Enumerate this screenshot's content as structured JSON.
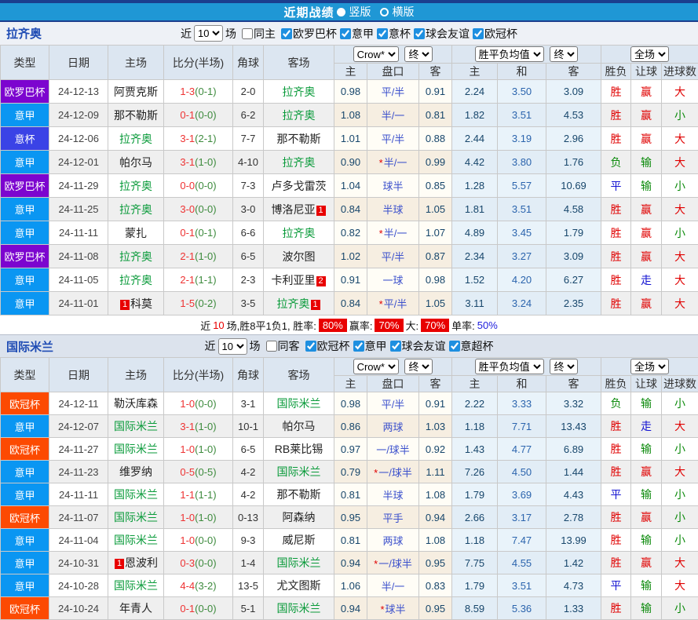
{
  "topbar": {
    "title": "近期战绩",
    "vertical_label": "竖版",
    "horizontal_label": "横版"
  },
  "colors": {
    "bar_blue": "#1f97d5",
    "bar_navy": "#1b3e8e",
    "rate_box_red": "#e80000",
    "team_green": "#089a39",
    "badges": {
      "欧罗巴杯": "#7c05cf",
      "意甲": "#0a96f2",
      "意杯": "#3a43e6",
      "欧冠杯": "#fc4a02"
    },
    "results": {
      "胜": "#e00000",
      "平": "#1414d2",
      "负": "#0b8a0b",
      "赢": "#e00000",
      "走": "#1414d2",
      "输": "#0b8a0b",
      "大": "#e00000",
      "小": "#0b8a0b"
    }
  },
  "table_header": {
    "type": "类型",
    "date": "日期",
    "home": "主场",
    "score": "比分(半场)",
    "corner": "角球",
    "away": "客场",
    "odds_company": "Crow*",
    "final_label": "终",
    "europe_label": "胜平负均值",
    "full_label": "全场",
    "sub_home": "主",
    "sub_line": "盘口",
    "sub_away": "客",
    "sub_eu_home": "主",
    "sub_eu_draw": "和",
    "sub_eu_away": "客",
    "sub_wdl": "胜负",
    "sub_handicap": "让球",
    "sub_goals": "进球数"
  },
  "sections": [
    {
      "team": "拉齐奥",
      "filters": {
        "near": "近",
        "count": "10",
        "unit": "场",
        "same_label": "同主",
        "same_checked": false,
        "competitions": [
          "欧罗巴杯",
          "意甲",
          "意杯",
          "球会友谊",
          "欧冠杯"
        ]
      },
      "rows": [
        {
          "type": "欧罗巴杯",
          "date": "24-12-13",
          "home": "阿贾克斯",
          "hG": 0,
          "hB": "",
          "score": "1-3",
          "half": "(0-1)",
          "corner": "2-0",
          "away": "拉齐奥",
          "aG": 1,
          "aB": "",
          "h": "0.98",
          "line": "平/半",
          "star": 0,
          "a": "0.91",
          "eh": "2.24",
          "ed": "3.50",
          "ea": "3.09",
          "r1": "胜",
          "r2": "赢",
          "r3": "大"
        },
        {
          "type": "意甲",
          "date": "24-12-09",
          "home": "那不勒斯",
          "hG": 0,
          "hB": "",
          "score": "0-1",
          "half": "(0-0)",
          "corner": "6-2",
          "away": "拉齐奥",
          "aG": 1,
          "aB": "",
          "h": "1.08",
          "line": "半/一",
          "star": 0,
          "a": "0.81",
          "eh": "1.82",
          "ed": "3.51",
          "ea": "4.53",
          "r1": "胜",
          "r2": "赢",
          "r3": "小"
        },
        {
          "type": "意杯",
          "date": "24-12-06",
          "home": "拉齐奥",
          "hG": 1,
          "hB": "",
          "score": "3-1",
          "half": "(2-1)",
          "corner": "7-7",
          "away": "那不勒斯",
          "aG": 0,
          "aB": "",
          "h": "1.01",
          "line": "平/半",
          "star": 0,
          "a": "0.88",
          "eh": "2.44",
          "ed": "3.19",
          "ea": "2.96",
          "r1": "胜",
          "r2": "赢",
          "r3": "大"
        },
        {
          "type": "意甲",
          "date": "24-12-01",
          "home": "帕尔马",
          "hG": 0,
          "hB": "",
          "score": "3-1",
          "half": "(1-0)",
          "corner": "4-10",
          "away": "拉齐奥",
          "aG": 1,
          "aB": "",
          "h": "0.90",
          "line": "半/一",
          "star": 1,
          "a": "0.99",
          "eh": "4.42",
          "ed": "3.80",
          "ea": "1.76",
          "r1": "负",
          "r2": "输",
          "r3": "大"
        },
        {
          "type": "欧罗巴杯",
          "date": "24-11-29",
          "home": "拉齐奥",
          "hG": 1,
          "hB": "",
          "score": "0-0",
          "half": "(0-0)",
          "corner": "7-3",
          "away": "卢多戈雷茨",
          "aG": 0,
          "aB": "",
          "h": "1.04",
          "line": "球半",
          "star": 0,
          "a": "0.85",
          "eh": "1.28",
          "ed": "5.57",
          "ea": "10.69",
          "r1": "平",
          "r2": "输",
          "r3": "小"
        },
        {
          "type": "意甲",
          "date": "24-11-25",
          "home": "拉齐奥",
          "hG": 1,
          "hB": "",
          "score": "3-0",
          "half": "(0-0)",
          "corner": "3-0",
          "away": "博洛尼亚",
          "aG": 0,
          "aB": "1",
          "h": "0.84",
          "line": "半球",
          "star": 0,
          "a": "1.05",
          "eh": "1.81",
          "ed": "3.51",
          "ea": "4.58",
          "r1": "胜",
          "r2": "赢",
          "r3": "大"
        },
        {
          "type": "意甲",
          "date": "24-11-11",
          "home": "蒙扎",
          "hG": 0,
          "hB": "",
          "score": "0-1",
          "half": "(0-1)",
          "corner": "6-6",
          "away": "拉齐奥",
          "aG": 1,
          "aB": "",
          "h": "0.82",
          "line": "半/一",
          "star": 1,
          "a": "1.07",
          "eh": "4.89",
          "ed": "3.45",
          "ea": "1.79",
          "r1": "胜",
          "r2": "赢",
          "r3": "小"
        },
        {
          "type": "欧罗巴杯",
          "date": "24-11-08",
          "home": "拉齐奥",
          "hG": 1,
          "hB": "",
          "score": "2-1",
          "half": "(1-0)",
          "corner": "6-5",
          "away": "波尔图",
          "aG": 0,
          "aB": "",
          "h": "1.02",
          "line": "平/半",
          "star": 0,
          "a": "0.87",
          "eh": "2.34",
          "ed": "3.27",
          "ea": "3.09",
          "r1": "胜",
          "r2": "赢",
          "r3": "大"
        },
        {
          "type": "意甲",
          "date": "24-11-05",
          "home": "拉齐奥",
          "hG": 1,
          "hB": "",
          "score": "2-1",
          "half": "(1-1)",
          "corner": "2-3",
          "away": "卡利亚里",
          "aG": 0,
          "aB": "2",
          "h": "0.91",
          "line": "一球",
          "star": 0,
          "a": "0.98",
          "eh": "1.52",
          "ed": "4.20",
          "ea": "6.27",
          "r1": "胜",
          "r2": "走",
          "r3": "大"
        },
        {
          "type": "意甲",
          "date": "24-11-01",
          "home": "科莫",
          "hG": 0,
          "hB": "1",
          "score": "1-5",
          "half": "(0-2)",
          "corner": "3-5",
          "away": "拉齐奥",
          "aG": 1,
          "aB": "1",
          "h": "0.84",
          "line": "平/半",
          "star": 1,
          "a": "1.05",
          "eh": "3.11",
          "ed": "3.24",
          "ea": "2.35",
          "r1": "胜",
          "r2": "赢",
          "r3": "大"
        }
      ],
      "summary": {
        "near": "近",
        "count": "10",
        "text": "场,胜8平1负1, 胜率:",
        "win": "80%",
        "l2": "赢率:",
        "v2": "70%",
        "l3": "大:",
        "v3": "70%",
        "l4": "单率:",
        "v4": "50%"
      }
    },
    {
      "team": "国际米兰",
      "filters": {
        "near": "近",
        "count": "10",
        "unit": "场",
        "same_label": "同客",
        "same_checked": false,
        "competitions": [
          "欧冠杯",
          "意甲",
          "球会友谊",
          "意超杯"
        ]
      },
      "rows": [
        {
          "type": "欧冠杯",
          "date": "24-12-11",
          "home": "勒沃库森",
          "hG": 0,
          "hB": "",
          "score": "1-0",
          "half": "(0-0)",
          "corner": "3-1",
          "away": "国际米兰",
          "aG": 1,
          "aB": "",
          "h": "0.98",
          "line": "平/半",
          "star": 0,
          "a": "0.91",
          "eh": "2.22",
          "ed": "3.33",
          "ea": "3.32",
          "r1": "负",
          "r2": "输",
          "r3": "小"
        },
        {
          "type": "意甲",
          "date": "24-12-07",
          "home": "国际米兰",
          "hG": 1,
          "hB": "",
          "score": "3-1",
          "half": "(1-0)",
          "corner": "10-1",
          "away": "帕尔马",
          "aG": 0,
          "aB": "",
          "h": "0.86",
          "line": "两球",
          "star": 0,
          "a": "1.03",
          "eh": "1.18",
          "ed": "7.71",
          "ea": "13.43",
          "r1": "胜",
          "r2": "走",
          "r3": "大"
        },
        {
          "type": "欧冠杯",
          "date": "24-11-27",
          "home": "国际米兰",
          "hG": 1,
          "hB": "",
          "score": "1-0",
          "half": "(1-0)",
          "corner": "6-5",
          "away": "RB莱比锡",
          "aG": 0,
          "aB": "",
          "h": "0.97",
          "line": "一/球半",
          "star": 0,
          "a": "0.92",
          "eh": "1.43",
          "ed": "4.77",
          "ea": "6.89",
          "r1": "胜",
          "r2": "输",
          "r3": "小"
        },
        {
          "type": "意甲",
          "date": "24-11-23",
          "home": "维罗纳",
          "hG": 0,
          "hB": "",
          "score": "0-5",
          "half": "(0-5)",
          "corner": "4-2",
          "away": "国际米兰",
          "aG": 1,
          "aB": "",
          "h": "0.79",
          "line": "一/球半",
          "star": 1,
          "a": "1.11",
          "eh": "7.26",
          "ed": "4.50",
          "ea": "1.44",
          "r1": "胜",
          "r2": "赢",
          "r3": "大"
        },
        {
          "type": "意甲",
          "date": "24-11-11",
          "home": "国际米兰",
          "hG": 1,
          "hB": "",
          "score": "1-1",
          "half": "(1-1)",
          "corner": "4-2",
          "away": "那不勒斯",
          "aG": 0,
          "aB": "",
          "h": "0.81",
          "line": "半球",
          "star": 0,
          "a": "1.08",
          "eh": "1.79",
          "ed": "3.69",
          "ea": "4.43",
          "r1": "平",
          "r2": "输",
          "r3": "小"
        },
        {
          "type": "欧冠杯",
          "date": "24-11-07",
          "home": "国际米兰",
          "hG": 1,
          "hB": "",
          "score": "1-0",
          "half": "(1-0)",
          "corner": "0-13",
          "away": "阿森纳",
          "aG": 0,
          "aB": "",
          "h": "0.95",
          "line": "平手",
          "star": 0,
          "a": "0.94",
          "eh": "2.66",
          "ed": "3.17",
          "ea": "2.78",
          "r1": "胜",
          "r2": "赢",
          "r3": "小"
        },
        {
          "type": "意甲",
          "date": "24-11-04",
          "home": "国际米兰",
          "hG": 1,
          "hB": "",
          "score": "1-0",
          "half": "(0-0)",
          "corner": "9-3",
          "away": "威尼斯",
          "aG": 0,
          "aB": "",
          "h": "0.81",
          "line": "两球",
          "star": 0,
          "a": "1.08",
          "eh": "1.18",
          "ed": "7.47",
          "ea": "13.99",
          "r1": "胜",
          "r2": "输",
          "r3": "小"
        },
        {
          "type": "意甲",
          "date": "24-10-31",
          "home": "恩波利",
          "hG": 0,
          "hB": "1",
          "score": "0-3",
          "half": "(0-0)",
          "corner": "1-4",
          "away": "国际米兰",
          "aG": 1,
          "aB": "",
          "h": "0.94",
          "line": "一/球半",
          "star": 1,
          "a": "0.95",
          "eh": "7.75",
          "ed": "4.55",
          "ea": "1.42",
          "r1": "胜",
          "r2": "赢",
          "r3": "大"
        },
        {
          "type": "意甲",
          "date": "24-10-28",
          "home": "国际米兰",
          "hG": 1,
          "hB": "",
          "score": "4-4",
          "half": "(3-2)",
          "corner": "13-5",
          "away": "尤文图斯",
          "aG": 0,
          "aB": "",
          "h": "1.06",
          "line": "半/一",
          "star": 0,
          "a": "0.83",
          "eh": "1.79",
          "ed": "3.51",
          "ea": "4.73",
          "r1": "平",
          "r2": "输",
          "r3": "大"
        },
        {
          "type": "欧冠杯",
          "date": "24-10-24",
          "home": "年青人",
          "hG": 0,
          "hB": "",
          "score": "0-1",
          "half": "(0-0)",
          "corner": "5-1",
          "away": "国际米兰",
          "aG": 1,
          "aB": "",
          "h": "0.94",
          "line": "球半",
          "star": 1,
          "a": "0.95",
          "eh": "8.59",
          "ed": "5.36",
          "ea": "1.33",
          "r1": "胜",
          "r2": "输",
          "r3": "小"
        }
      ]
    }
  ]
}
